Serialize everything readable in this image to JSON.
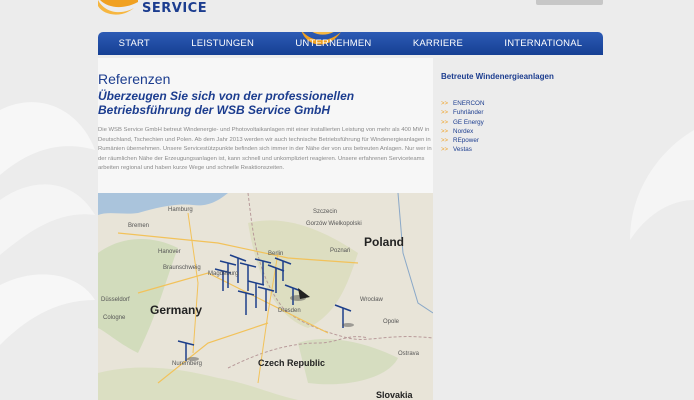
{
  "colors": {
    "brand_blue": "#1c3d8f",
    "nav_blue": "#1f4da3",
    "accent_orange": "#f0a020"
  },
  "logo": {
    "text": "SERVICE",
    "icon": "sun-swoosh-logo-icon"
  },
  "nav": {
    "items": [
      {
        "label": "START"
      },
      {
        "label": "LEISTUNGEN"
      },
      {
        "label": "UNTERNEHMEN",
        "active": true
      },
      {
        "label": "KARRIERE"
      },
      {
        "label": "INTERNATIONAL"
      }
    ]
  },
  "main": {
    "title": "Referenzen",
    "subtitle": "Überzeugen Sie sich von der professionellen Betriebsführung der WSB Service GmbH",
    "body": "Die WSB Service GmbH betreut Windenergie- und Photovoltaikanlagen mit einer installierten Leistung von mehr als 400 MW in Deutschland, Tschechien und Polen. Ab dem Jahr 2013 werden wir auch technische Betriebsführung für Windenergieanlagen in Rumänien übernehmen. Unsere Servicestützpunkte befinden sich immer in der Nähe der von uns betreuten Anlagen. Nur wer in der räumlichen Nähe der Erzeugungsanlagen ist, kann schnell und unkompliziert reagieren. Unsere erfahrenen Serviceteams arbeiten regional und haben kurze Wege und schnelle Reaktionszeiten."
  },
  "map": {
    "cities": [
      "Hamburg",
      "Szczecin",
      "Gorzów Wielkopolski",
      "Bremen",
      "Poznań",
      "Hanover",
      "Berlin",
      "Braunschweig",
      "Magdeburg",
      "Wrocław",
      "Düsseldorf",
      "Cologne",
      "Dresden",
      "Nuremberg",
      "Opole",
      "Ostrava"
    ],
    "countries": [
      "Poland",
      "Germany",
      "Czech Republic",
      "Slovakia"
    ]
  },
  "sidebar": {
    "title": "Betreute Windenergieanlagen",
    "items": [
      "ENERCON",
      "Fuhrländer",
      "GE Energy",
      "Nordex",
      "REpower",
      "Vestas"
    ]
  }
}
